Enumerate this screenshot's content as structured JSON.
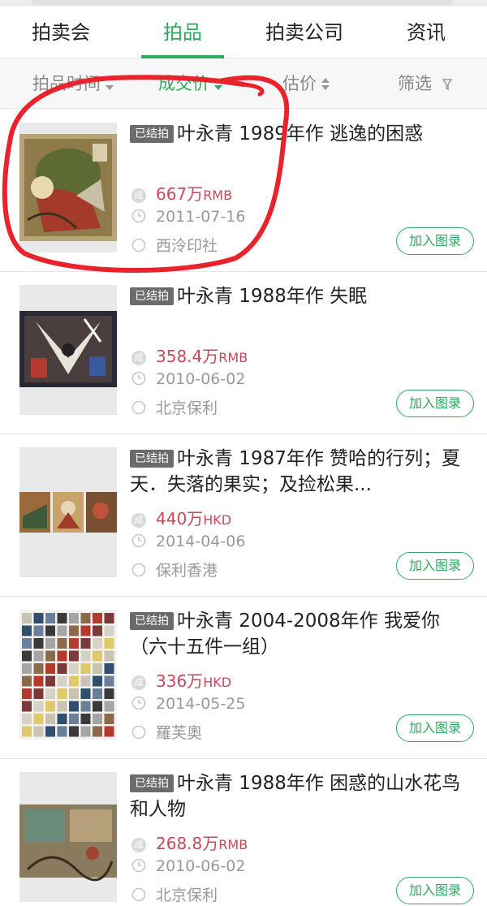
{
  "tabs": [
    {
      "label": "拍卖会"
    },
    {
      "label": "拍品"
    },
    {
      "label": "拍卖公司"
    },
    {
      "label": "资讯"
    }
  ],
  "active_tab": "拍品",
  "filters": [
    {
      "label": "拍品时间"
    },
    {
      "label": "成交价"
    },
    {
      "label": "估价"
    },
    {
      "label": "筛选"
    }
  ],
  "active_filter": "成交价",
  "colors": {
    "accent": "#2daa5e",
    "price": "#c8475a",
    "annotation": "#e8232b"
  },
  "items": [
    {
      "badge": "已结拍",
      "title": "叶永青 1989年作 逃逸的困惑",
      "deal_icon": "成",
      "price": "667万",
      "currency": "RMB",
      "date": "2011-07-16",
      "house": "西泠印社",
      "button": "加入图录"
    },
    {
      "badge": "已结拍",
      "title": "叶永青 1988年作 失眠",
      "deal_icon": "成",
      "price": "358.4万",
      "currency": "RMB",
      "date": "2010-06-02",
      "house": "北京保利",
      "button": "加入图录"
    },
    {
      "badge": "已结拍",
      "title": "叶永青 1987年作 赞哈的行列；夏天．失落的果实；及捡松果...",
      "deal_icon": "成",
      "price": "440万",
      "currency": "HKD",
      "date": "2014-04-06",
      "house": "保利香港",
      "button": "加入图录"
    },
    {
      "badge": "已结拍",
      "title": "叶永青 2004-2008年作 我爱你 （六十五件一组）",
      "deal_icon": "成",
      "price": "336万",
      "currency": "HKD",
      "date": "2014-05-25",
      "house": "羅芙奧",
      "button": "加入图录"
    },
    {
      "badge": "已结拍",
      "title": "叶永青 1988年作 困惑的山水花鸟和人物",
      "deal_icon": "成",
      "price": "268.8万",
      "currency": "RMB",
      "date": "2010-06-02",
      "house": "北京保利",
      "button": "加入图录"
    }
  ],
  "icons": {
    "sort": "sort-arrows-icon",
    "filter": "funnel-icon",
    "deal": "deal-badge-icon",
    "date": "clock-icon",
    "house": "circle-icon"
  }
}
